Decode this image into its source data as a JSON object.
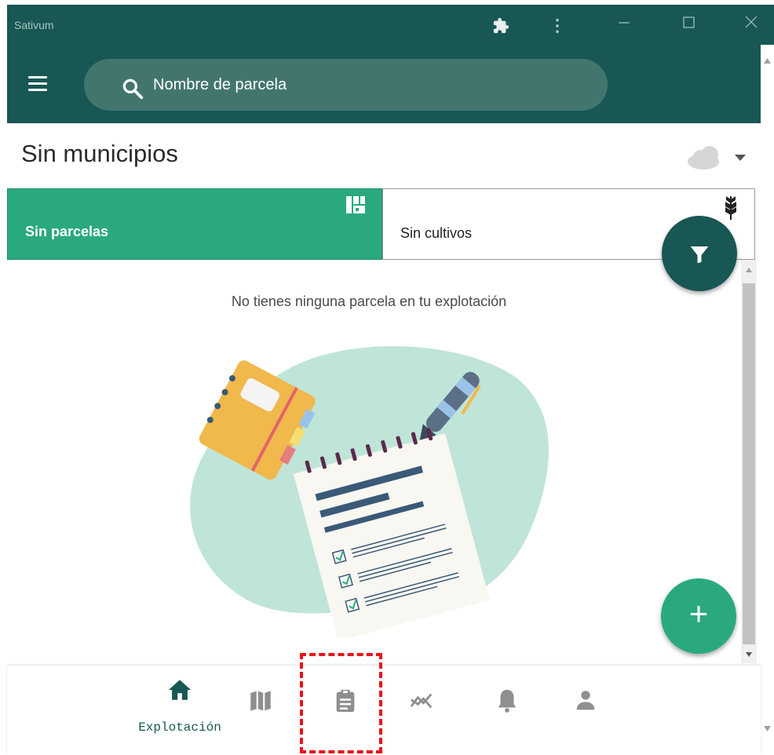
{
  "window": {
    "title": "Sativum",
    "icons": [
      "puzzle-icon",
      "more-vert-icon",
      "minimize-icon",
      "maximize-icon",
      "close-icon"
    ]
  },
  "search": {
    "placeholder": "Nombre de parcela"
  },
  "location": {
    "municipio": "Sin municipios"
  },
  "tabs": [
    {
      "label": "Sin parcelas",
      "icon": "grid-icon",
      "active": true
    },
    {
      "label": "Sin cultivos",
      "icon": "wheat-icon",
      "active": false
    }
  ],
  "empty_state": {
    "message": "No tienes ninguna parcela en tu explotación"
  },
  "fabs": {
    "filter_icon": "filter-icon",
    "add_label": "+"
  },
  "bottom_nav": {
    "items": [
      {
        "label": "Explotación",
        "icon": "home-icon",
        "active": true
      },
      {
        "label": "",
        "icon": "map-icon"
      },
      {
        "label": "",
        "icon": "clipboard-icon"
      },
      {
        "label": "",
        "icon": "trend-icon"
      },
      {
        "label": "",
        "icon": "bell-icon"
      },
      {
        "label": "",
        "icon": "person-icon"
      }
    ]
  },
  "colors": {
    "primary_dark": "#185753",
    "accent_green": "#2aa97f",
    "search_bg": "#43756f",
    "highlight_red": "#e8141b"
  }
}
